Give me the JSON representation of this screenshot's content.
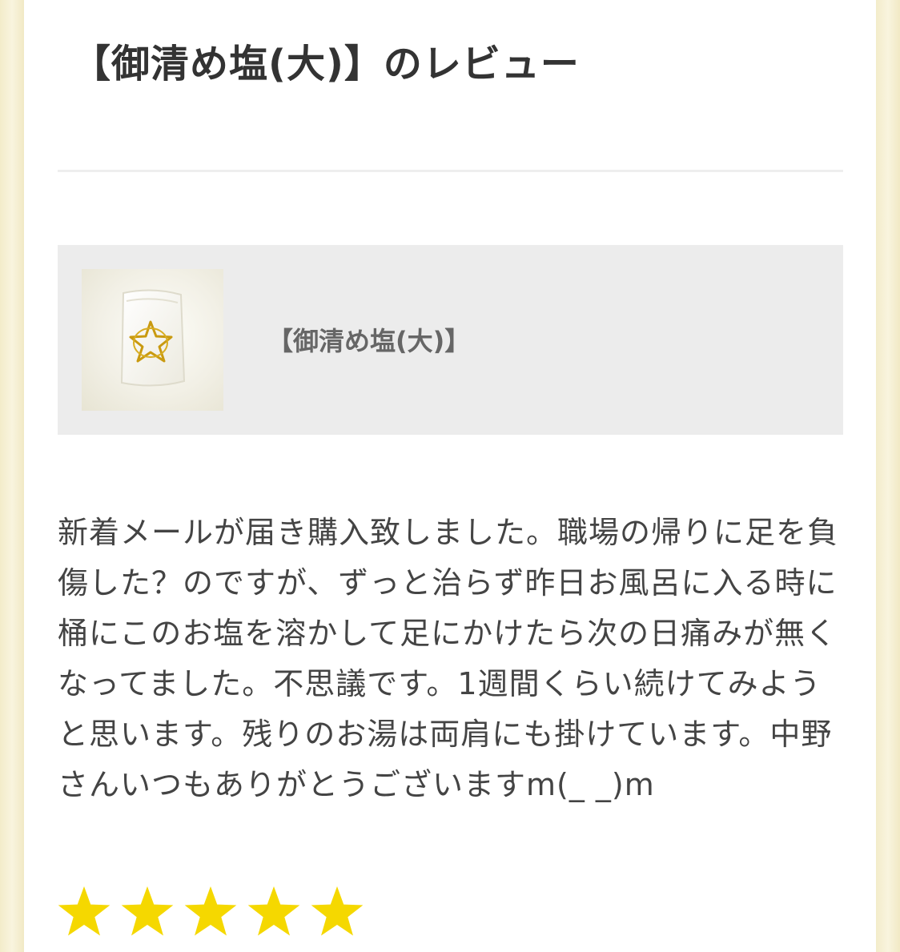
{
  "page": {
    "title": "【御清め塩(大)】のレビュー"
  },
  "product": {
    "name": "【御清め塩(大)】",
    "image_icon": "salt-pouch-with-gold-star-icon"
  },
  "review": {
    "text": "新着メールが届き購入致しました。職場の帰りに足を負傷した？のですが、ずっと治らず昨日お風呂に入る時に桶にこのお塩を溶かして足にかけたら次の日痛みが無くなってました。不思議です。1週間くらい続けてみようと思います。残りのお湯は両肩にも掛けています。中野さんいつもありがとうございますm(_ _)m",
    "rating": 5,
    "rating_max": 5
  },
  "colors": {
    "star": "#f5d800",
    "background": "#f7f1d8",
    "card": "#ffffff",
    "product_box": "#ececec"
  }
}
